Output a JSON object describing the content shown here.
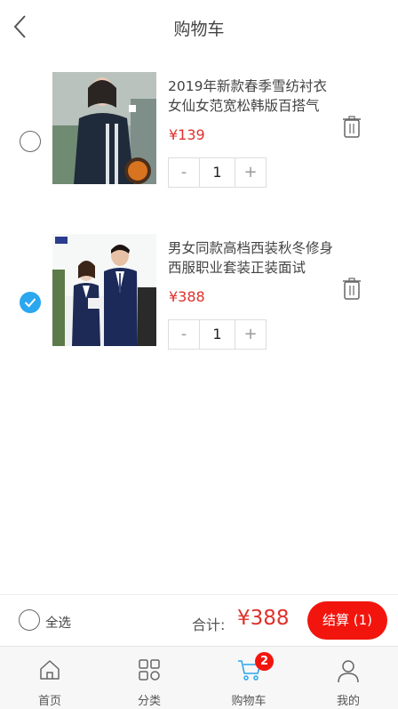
{
  "header": {
    "title": "购物车"
  },
  "items": [
    {
      "title": "2019年新款春季雪纺衬衣女仙女范宽松韩版百搭气",
      "price": "¥139",
      "quantity": "1",
      "checked": false,
      "image": "woman-navy-sweater-photo"
    },
    {
      "title": "男女同款高档西装秋冬修身西服职业套装正装面试",
      "price": "¥388",
      "quantity": "1",
      "checked": true,
      "image": "business-suits-couple-photo"
    }
  ],
  "stepper": {
    "minus": "-",
    "plus": "+"
  },
  "checkout": {
    "select_all": "全选",
    "total_label": "合计:",
    "total_amount": "¥388",
    "button": "结算 (1)"
  },
  "tabbar": {
    "tabs": [
      {
        "label": "首页",
        "icon": "home-icon"
      },
      {
        "label": "分类",
        "icon": "category-grid-icon"
      },
      {
        "label": "购物车",
        "icon": "cart-icon",
        "badge": "2",
        "active": true
      },
      {
        "label": "我的",
        "icon": "user-icon"
      }
    ]
  },
  "colors": {
    "accent": "#2aa7ef",
    "price": "#e0312b",
    "checkout_button": "#f2150e",
    "active_tab": "#2aa7ef"
  }
}
